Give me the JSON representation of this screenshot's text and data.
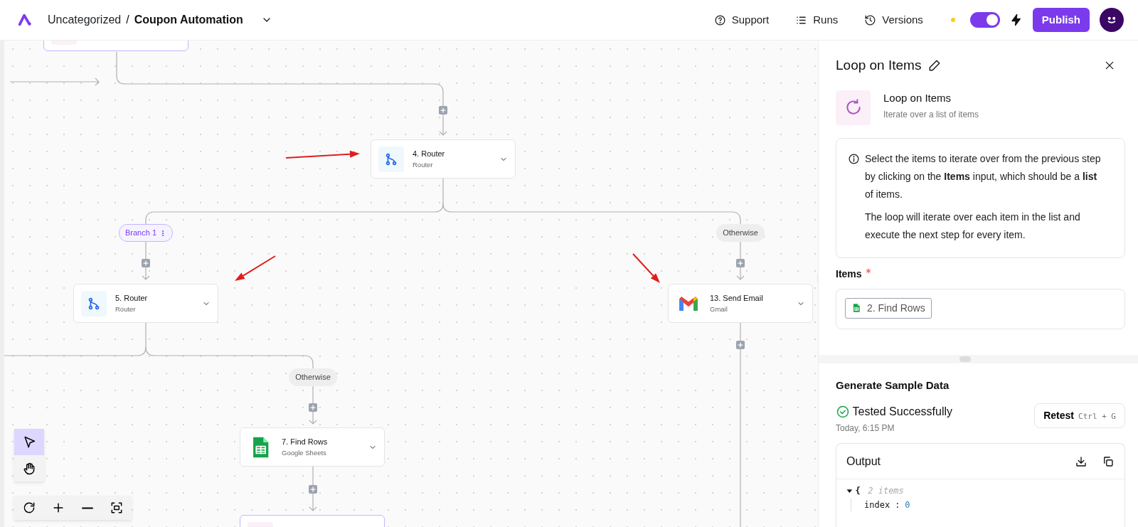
{
  "topbar": {
    "folder": "Uncategorized",
    "separator": "/",
    "flow_name": "Coupon Automation",
    "nav": [
      {
        "kind": "support",
        "label": "Support"
      },
      {
        "kind": "runs",
        "label": "Runs"
      },
      {
        "kind": "versions",
        "label": "Versions"
      }
    ],
    "flow_enabled": true,
    "publish": "Publish"
  },
  "canvas": {
    "nodes": [
      {
        "kind": "loop"
      },
      {
        "kind": "router",
        "title": "4. Router",
        "subtitle": "Router"
      },
      {
        "kind": "router",
        "title": "5. Router",
        "subtitle": "Router"
      },
      {
        "kind": "gmail",
        "title": "13. Send Email",
        "subtitle": "Gmail"
      },
      {
        "kind": "sheets",
        "title": "7. Find Rows",
        "subtitle": "Google Sheets"
      },
      {
        "kind": "loop"
      }
    ],
    "branches": [
      {
        "label": "Branch 1",
        "selected": true
      },
      {
        "label": "Otherwise",
        "selected": false
      },
      {
        "label": "Otherwise",
        "selected": false
      }
    ],
    "tools": [
      {
        "kind": "select",
        "selected": true
      },
      {
        "kind": "hand",
        "selected": false
      }
    ]
  },
  "panel": {
    "title": "Loop on Items",
    "step_name": "Loop on Items",
    "step_description": "Iterate over a list of items",
    "info": [
      "Select the items to iterate over from the previous step by clicking on the **Items** input, which should be a **list** of items.",
      "The loop will iterate over each item in the list and execute the next step for every item."
    ],
    "items_label": "Items",
    "items_required": true,
    "items_value": "2. Find Rows",
    "sample": {
      "heading": "Generate Sample Data",
      "status": "Tested Successfully",
      "time": "Today, 6:15 PM",
      "retest": "Retest",
      "shortcut": "Ctrl + G",
      "output": {
        "title": "Output",
        "expanded": true,
        "brace": "{",
        "count": "2 items",
        "rows": [
          {
            "key": "index",
            "sep": ":",
            "value": "0"
          }
        ]
      }
    }
  }
}
